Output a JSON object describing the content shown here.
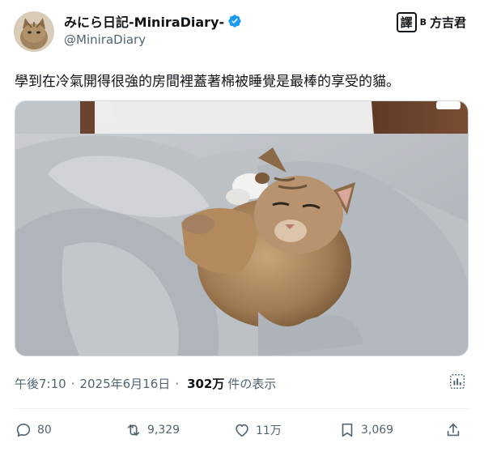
{
  "author": {
    "display_name": "みにら日記-MiniraDiary-",
    "handle": "@MiniraDiary",
    "avatar_icon": "cat-avatar-icon",
    "verified_icon": "verified-badge-icon"
  },
  "credit": {
    "mark": "譯",
    "b": "B",
    "name": "方吉君"
  },
  "tweet": {
    "text": "學到在冷氣開得很強的房間裡蓋著棉被睡覺是最棒的享受的貓。",
    "media_icon": "cat-under-blanket-photo"
  },
  "meta": {
    "time": "午後7:10",
    "date": "2025年6月16日",
    "views_count": "302万",
    "views_label": "件の表示",
    "separator": "·"
  },
  "actions": {
    "reply": {
      "icon": "reply-icon",
      "count": "80"
    },
    "retweet": {
      "icon": "retweet-icon",
      "count": "9,329"
    },
    "like": {
      "icon": "heart-icon",
      "count": "11万"
    },
    "bookmark": {
      "icon": "bookmark-icon",
      "count": "3,069"
    },
    "share": {
      "icon": "share-icon"
    }
  },
  "colors": {
    "text_primary": "#0f1419",
    "text_secondary": "#536471",
    "verified_blue": "#1d9bf0",
    "border": "#cfd9de"
  }
}
